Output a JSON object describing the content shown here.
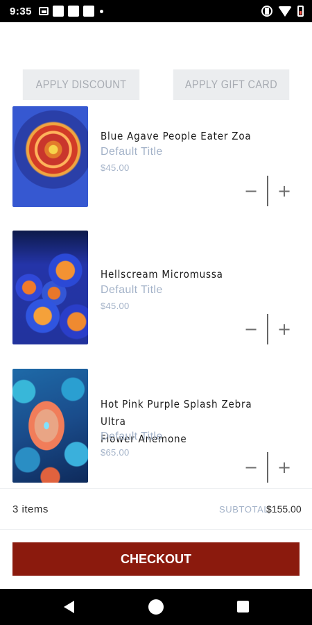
{
  "status_bar": {
    "time": "9:35"
  },
  "promo": {
    "discount_label": "APPLY DISCOUNT",
    "gift_card_label": "APPLY GIFT CARD"
  },
  "items": [
    {
      "title_lines": [
        "Blue Agave People Eater Zoa"
      ],
      "variant": "Default Title",
      "price": "$45.00",
      "minus": "−",
      "plus": "+"
    },
    {
      "title_lines": [
        "Hellscream Micromussa"
      ],
      "variant": "Default Title",
      "price": "$45.00",
      "minus": "−",
      "plus": "+"
    },
    {
      "title_lines": [
        "Hot Pink Purple Splash Zebra Ultra",
        "Flower Anemone"
      ],
      "variant": "Default Title",
      "price": "$65.00",
      "minus": "−",
      "plus": "+"
    }
  ],
  "summary": {
    "items_count": "3 items",
    "subtotal_label": "SUBTOTAL",
    "subtotal_value": "$155.00"
  },
  "checkout": {
    "label": "CHECKOUT"
  },
  "colors": {
    "checkout_bg": "#8b1a0d",
    "promo_bg": "#ebedef",
    "muted_text": "#a3b2c8"
  },
  "icons": {
    "status": [
      "image-icon",
      "notification-square-icon",
      "vibrate-icon",
      "wifi-icon",
      "battery-icon"
    ],
    "nav": [
      "back-icon",
      "home-icon",
      "recents-icon"
    ]
  }
}
